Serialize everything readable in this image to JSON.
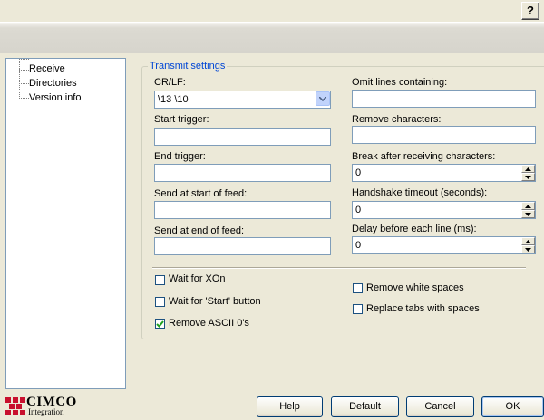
{
  "titlebar": {
    "help_label": "?"
  },
  "tree": {
    "items": [
      {
        "label": "Receive"
      },
      {
        "label": "Directories"
      },
      {
        "label": "Version info"
      }
    ]
  },
  "transmit": {
    "group_title": "Transmit settings",
    "crlf": {
      "label": "CR/LF:",
      "value": "\\13 \\10"
    },
    "start_trigger": {
      "label": "Start trigger:",
      "value": ""
    },
    "end_trigger": {
      "label": "End trigger:",
      "value": ""
    },
    "send_start": {
      "label": "Send at start of feed:",
      "value": ""
    },
    "send_end": {
      "label": "Send at end of feed:",
      "value": ""
    },
    "omit_lines": {
      "label": "Omit lines containing:",
      "value": ""
    },
    "remove_chars": {
      "label": "Remove characters:",
      "value": ""
    },
    "break_after": {
      "label": "Break after receiving characters:",
      "value": "0"
    },
    "handshake": {
      "label": "Handshake timeout (seconds):",
      "value": "0"
    },
    "delay": {
      "label": "Delay before each line (ms):",
      "value": "0"
    }
  },
  "options": {
    "wait_xon": {
      "label": "Wait for XOn",
      "checked": false
    },
    "wait_start": {
      "label": "Wait for 'Start' button",
      "checked": false
    },
    "remove_ascii": {
      "label": "Remove ASCII 0's",
      "checked": true
    },
    "remove_white": {
      "label": "Remove white spaces",
      "checked": false
    },
    "replace_tabs": {
      "label": "Replace tabs with spaces",
      "checked": false
    }
  },
  "footer": {
    "logo_top": "CIMCO",
    "logo_bottom": "Integration",
    "help": "Help",
    "default": "Default",
    "cancel": "Cancel",
    "ok": "OK"
  },
  "colors": {
    "group_title": "#0046d5",
    "check_mark": "#21a121",
    "field_border": "#7f9db9",
    "logo_red": "#c8102e"
  }
}
